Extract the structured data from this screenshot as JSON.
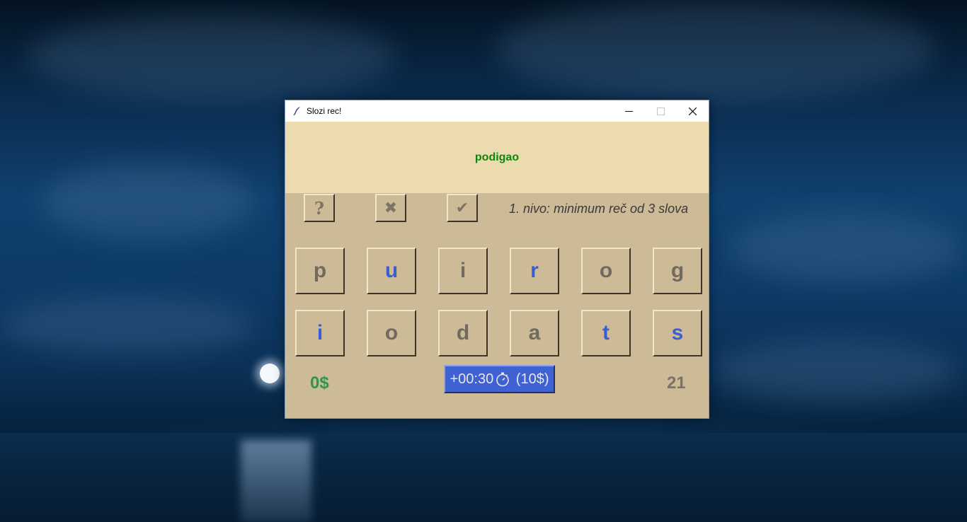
{
  "window": {
    "title": "Slozi rec!",
    "minimize_glyph": "—",
    "maximize_glyph": "☐",
    "close_glyph": "✕"
  },
  "word_display": "podigao",
  "toolbar": {
    "hint_glyph": "?",
    "clear_glyph": "✖",
    "confirm_glyph": "✔",
    "level_text": "1. nivo: minimum reč od 3 slova"
  },
  "letters": [
    {
      "char": "p",
      "vowel": false
    },
    {
      "char": "u",
      "vowel": true
    },
    {
      "char": "i",
      "vowel": false
    },
    {
      "char": "r",
      "vowel": true
    },
    {
      "char": "o",
      "vowel": false
    },
    {
      "char": "g",
      "vowel": false
    },
    {
      "char": "i",
      "vowel": true
    },
    {
      "char": "o",
      "vowel": false
    },
    {
      "char": "d",
      "vowel": false
    },
    {
      "char": "a",
      "vowel": false
    },
    {
      "char": "t",
      "vowel": true
    },
    {
      "char": "s",
      "vowel": true
    }
  ],
  "status": {
    "money": "0$",
    "time_bonus_left": "+00:30",
    "time_bonus_right": " (10$)",
    "counter": "21"
  },
  "colors": {
    "window_bg": "#cdbb97",
    "word_area_bg": "#eddbb0",
    "word_color": "#0a8a0a",
    "letter_gray": "#706a60",
    "letter_blue": "#3a5ed0",
    "money_green": "#2f9650",
    "time_button": "#3e62d4"
  }
}
